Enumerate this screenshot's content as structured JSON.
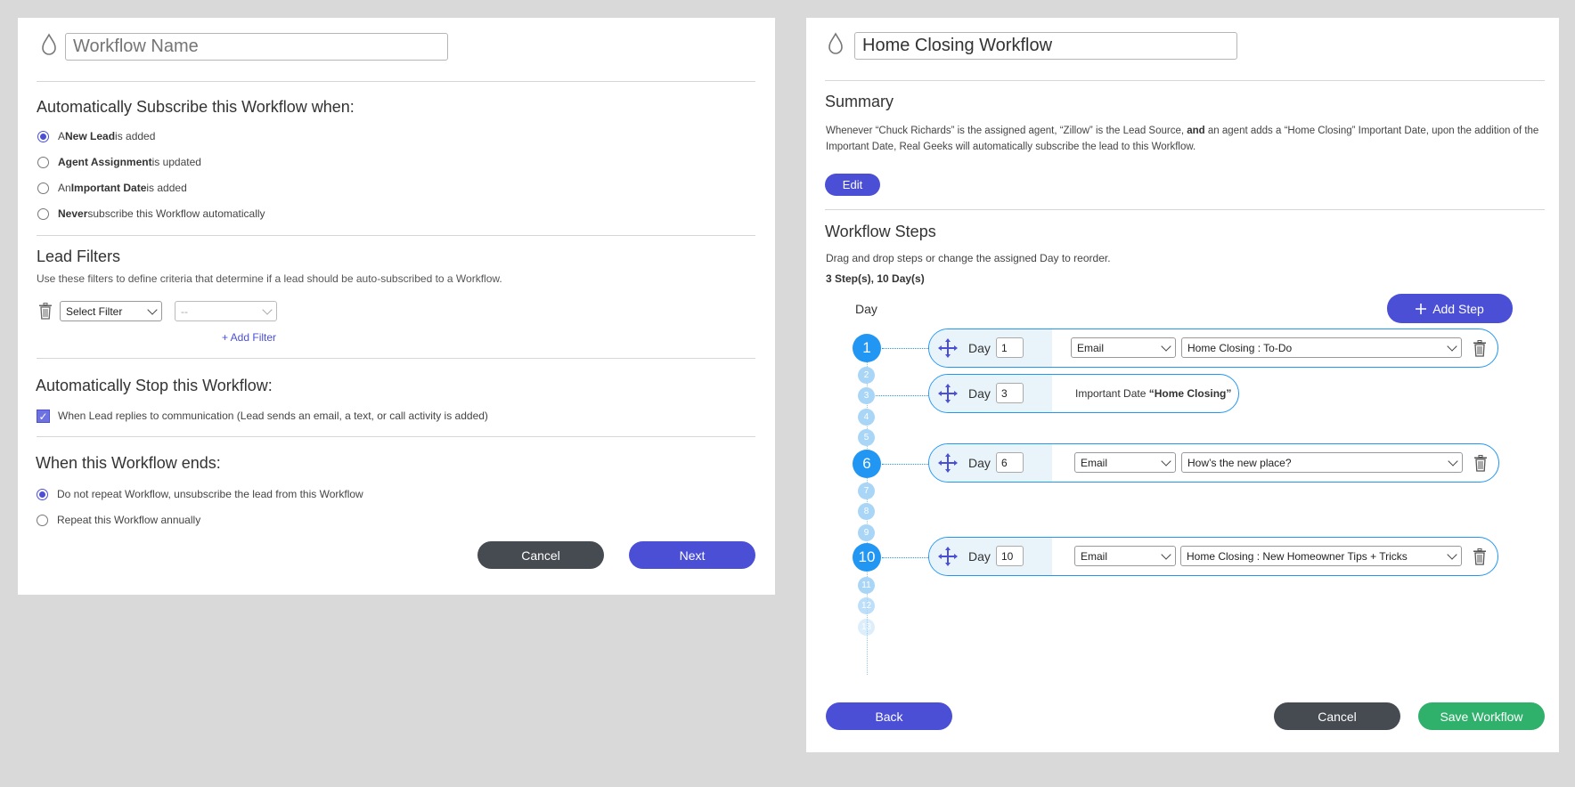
{
  "left_panel": {
    "workflow_name_placeholder": "Workflow Name",
    "subscribe_heading": "Automatically Subscribe this Workflow when:",
    "subscribe_options": [
      {
        "pre": "A ",
        "bold": "New Lead",
        "post": " is added",
        "selected": true
      },
      {
        "pre": "",
        "bold": "Agent Assignment",
        "post": " is updated",
        "selected": false
      },
      {
        "pre": "An ",
        "bold": "Important Date",
        "post": " is added",
        "selected": false
      },
      {
        "pre": "",
        "bold": "Never",
        "post": " subscribe this Workflow automatically",
        "selected": false
      }
    ],
    "lead_filters_heading": "Lead Filters",
    "lead_filters_desc": "Use these filters to define criteria that determine if a lead should be auto-subscribed to a Workflow.",
    "filter_select_value": "Select Filter",
    "filter_value_select": "--",
    "add_filter_label": "+ Add Filter",
    "stop_heading": "Automatically Stop this Workflow:",
    "stop_option_label": "When Lead replies to communication (Lead sends an email, a text, or call activity is added)",
    "stop_option_checked": true,
    "ends_heading": "When this Workflow ends:",
    "ends_options": [
      {
        "label": "Do not repeat Workflow, unsubscribe the lead from this Workflow",
        "selected": true
      },
      {
        "label": "Repeat this Workflow annually",
        "selected": false
      }
    ],
    "cancel_label": "Cancel",
    "next_label": "Next"
  },
  "right_panel": {
    "workflow_name_value": "Home Closing Workflow",
    "summary_heading": "Summary",
    "summary_parts": {
      "p1": "Whenever “Chuck Richards” is the assigned agent, “Zillow” is the Lead Source, ",
      "bold": "and",
      "p2": " an agent adds a “Home Closing” Important Date, upon the addition of the Important Date, Real Geeks will automatically subscribe the lead to this Workflow."
    },
    "edit_label": "Edit",
    "steps_heading": "Workflow Steps",
    "steps_desc": "Drag and drop steps or change the assigned Day to reorder.",
    "steps_count": "3 Step(s), 10 Day(s)",
    "day_column_label": "Day",
    "add_step_label": "Add Step",
    "timeline_days": [
      "1",
      "2",
      "3",
      "4",
      "5",
      "6",
      "7",
      "8",
      "9",
      "10",
      "11",
      "12",
      "13"
    ],
    "day_label": "Day",
    "steps": [
      {
        "day": "1",
        "type": "Email",
        "template": "Home Closing : To-Do"
      },
      {
        "day": "3",
        "important_prefix": "Important Date ",
        "important_name": "“Home Closing”"
      },
      {
        "day": "6",
        "type": "Email",
        "template": "How’s the new place?"
      },
      {
        "day": "10",
        "type": "Email",
        "template": "Home Closing : New Homeowner Tips + Tricks"
      }
    ],
    "back_label": "Back",
    "cancel_label": "Cancel",
    "save_label": "Save Workflow"
  },
  "colors": {
    "accent": "#4a4fd6",
    "timeline_blue": "#2196f3",
    "save_green": "#2fb06b",
    "cancel_dark": "#464b52"
  },
  "icons": [
    "drop-icon",
    "trash-icon",
    "move-icon",
    "plus-icon",
    "chevron-down-icon",
    "checkmark-icon"
  ]
}
